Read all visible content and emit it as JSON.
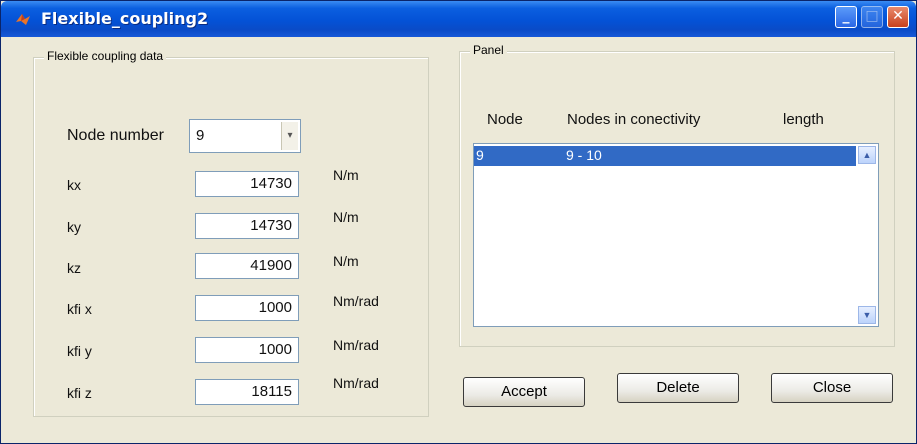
{
  "window": {
    "title": "Flexible_coupling2"
  },
  "coupling": {
    "group_label": "Flexible coupling data",
    "node_label": "Node number",
    "node_value": "9",
    "fields": [
      {
        "label": "kx",
        "value": "14730",
        "unit": "N/m"
      },
      {
        "label": "ky",
        "value": "14730",
        "unit": "N/m"
      },
      {
        "label": "kz",
        "value": "41900",
        "unit": "N/m"
      },
      {
        "label": "kfi x",
        "value": "1000",
        "unit": "Nm/rad"
      },
      {
        "label": "kfi y",
        "value": "1000",
        "unit": "Nm/rad"
      },
      {
        "label": "kfi z",
        "value": "18115",
        "unit": "Nm/rad"
      }
    ]
  },
  "panel": {
    "group_label": "Panel",
    "columns": [
      "Node",
      "Nodes in conectivity",
      "length"
    ],
    "rows": [
      {
        "node": "9",
        "connectivity": "9 - 10",
        "length": ""
      }
    ]
  },
  "buttons": {
    "accept": "Accept",
    "delete": "Delete",
    "close": "Close"
  },
  "colors": {
    "title_bar": "#0452d6",
    "selection": "#316ac5",
    "dialog_bg": "#ece9d8"
  }
}
